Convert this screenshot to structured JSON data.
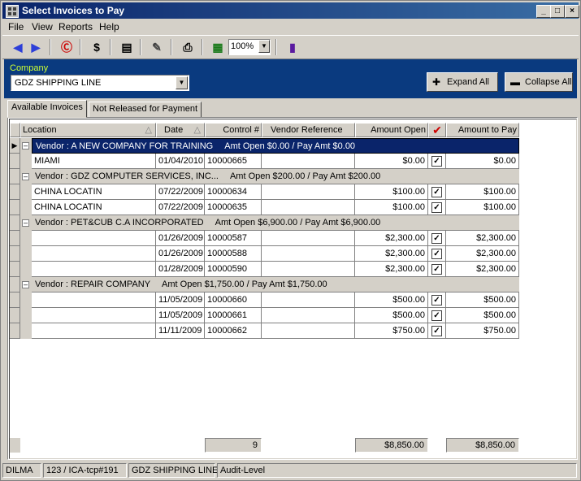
{
  "window": {
    "title": "Select Invoices to Pay"
  },
  "menu": [
    "File",
    "View",
    "Reports",
    "Help"
  ],
  "toolbar": {
    "zoom": "100%"
  },
  "company": {
    "label": "Company",
    "value": "GDZ SHIPPING LINE",
    "expand_all": "Expand All",
    "collapse_all": "Collapse All"
  },
  "tabs": [
    "Available Invoices",
    "Not Released for Payment"
  ],
  "columns": {
    "location": "Location",
    "date": "Date",
    "control": "Control #",
    "vendor_ref": "Vendor Reference",
    "amount_open": "Amount Open",
    "amount_to_pay": "Amount to Pay"
  },
  "groups": [
    {
      "vendor": "Vendor : A NEW COMPANY FOR TRAINING",
      "summary": "Amt Open $0.00 / Pay Amt $0.00",
      "rows": [
        {
          "location": "MIAMI",
          "date": "01/04/2010",
          "control": "10000665",
          "vendor_ref": "",
          "amount_open": "$0.00",
          "checked": true,
          "amount_to_pay": "$0.00"
        }
      ]
    },
    {
      "vendor": "Vendor : GDZ COMPUTER SERVICES, INC...",
      "summary": "Amt Open $200.00 / Pay Amt $200.00",
      "rows": [
        {
          "location": "CHINA LOCATIN",
          "date": "07/22/2009",
          "control": "10000634",
          "vendor_ref": "",
          "amount_open": "$100.00",
          "checked": true,
          "amount_to_pay": "$100.00"
        },
        {
          "location": "CHINA LOCATIN",
          "date": "07/22/2009",
          "control": "10000635",
          "vendor_ref": "",
          "amount_open": "$100.00",
          "checked": true,
          "amount_to_pay": "$100.00"
        }
      ]
    },
    {
      "vendor": "Vendor : PET&CUB C.A INCORPORATED",
      "summary": "Amt Open $6,900.00 / Pay Amt $6,900.00",
      "rows": [
        {
          "location": "",
          "date": "01/26/2009",
          "control": "10000587",
          "vendor_ref": "",
          "amount_open": "$2,300.00",
          "checked": true,
          "amount_to_pay": "$2,300.00"
        },
        {
          "location": "",
          "date": "01/26/2009",
          "control": "10000588",
          "vendor_ref": "",
          "amount_open": "$2,300.00",
          "checked": true,
          "amount_to_pay": "$2,300.00"
        },
        {
          "location": "",
          "date": "01/28/2009",
          "control": "10000590",
          "vendor_ref": "",
          "amount_open": "$2,300.00",
          "checked": true,
          "amount_to_pay": "$2,300.00"
        }
      ]
    },
    {
      "vendor": "Vendor : REPAIR COMPANY",
      "summary": "Amt Open $1,750.00 / Pay Amt $1,750.00",
      "rows": [
        {
          "location": "",
          "date": "11/05/2009",
          "control": "10000660",
          "vendor_ref": "",
          "amount_open": "$500.00",
          "checked": true,
          "amount_to_pay": "$500.00"
        },
        {
          "location": "",
          "date": "11/05/2009",
          "control": "10000661",
          "vendor_ref": "",
          "amount_open": "$500.00",
          "checked": true,
          "amount_to_pay": "$500.00"
        },
        {
          "location": "",
          "date": "11/11/2009",
          "control": "10000662",
          "vendor_ref": "",
          "amount_open": "$750.00",
          "checked": true,
          "amount_to_pay": "$750.00"
        }
      ]
    }
  ],
  "totals": {
    "count": "9",
    "amount_open": "$8,850.00",
    "amount_to_pay": "$8,850.00"
  },
  "status": [
    "DILMA",
    "123 / ICA-tcp#191",
    "GDZ SHIPPING LINE",
    "Audit-Level"
  ]
}
